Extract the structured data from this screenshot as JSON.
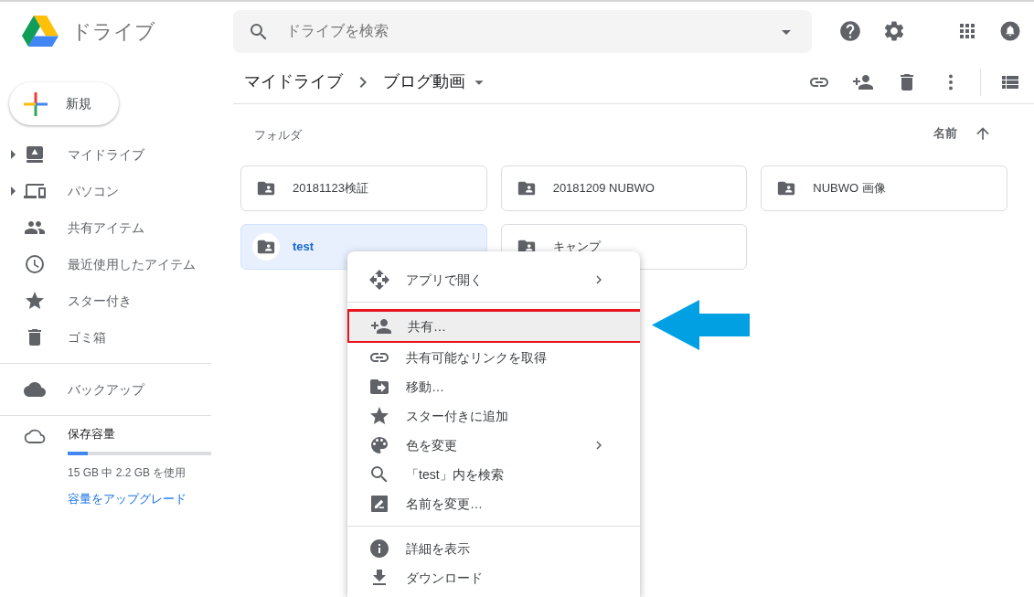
{
  "header": {
    "app_name": "ドライブ",
    "search": {
      "placeholder": "ドライブを検索"
    }
  },
  "sidebar": {
    "new_button": "新規",
    "items": [
      {
        "label": "マイドライブ",
        "expandable": true
      },
      {
        "label": "パソコン",
        "expandable": true
      },
      {
        "label": "共有アイテム",
        "expandable": false
      },
      {
        "label": "最近使用したアイテム",
        "expandable": false
      },
      {
        "label": "スター付き",
        "expandable": false
      },
      {
        "label": "ゴミ箱",
        "expandable": false
      }
    ],
    "backup": "バックアップ",
    "storage": {
      "label": "保存容量",
      "level": 0.14,
      "usage": "15 GB 中 2.2 GB を使用",
      "upgrade_link": "容量をアップグレード"
    }
  },
  "breadcrumb": [
    "マイドライブ",
    "ブログ動画"
  ],
  "section_title": "フォルダ",
  "sort": {
    "label": "名前"
  },
  "folders": [
    {
      "name": "20181123検証",
      "selected": false
    },
    {
      "name": "20181209 NUBWO",
      "selected": false
    },
    {
      "name": "NUBWO 画像",
      "selected": false
    },
    {
      "name": "test",
      "selected": true
    },
    {
      "name": "キャンプ",
      "selected": false
    }
  ],
  "context_menu": [
    [
      {
        "label": "アプリで開く",
        "submenu": true,
        "highlighted": false
      }
    ],
    [
      {
        "label": "共有…",
        "submenu": false,
        "highlighted": true
      },
      {
        "label": "共有可能なリンクを取得",
        "submenu": false,
        "highlighted": false
      },
      {
        "label": "移動…",
        "submenu": false,
        "highlighted": false
      },
      {
        "label": "スター付きに追加",
        "submenu": false,
        "highlighted": false
      },
      {
        "label": "色を変更",
        "submenu": true,
        "highlighted": false
      },
      {
        "label": "「test」内を検索",
        "submenu": false,
        "highlighted": false
      },
      {
        "label": "名前を変更…",
        "submenu": false,
        "highlighted": false
      }
    ],
    [
      {
        "label": "詳細を表示",
        "submenu": false,
        "highlighted": false
      },
      {
        "label": "ダウンロード",
        "submenu": false,
        "highlighted": false
      }
    ]
  ]
}
